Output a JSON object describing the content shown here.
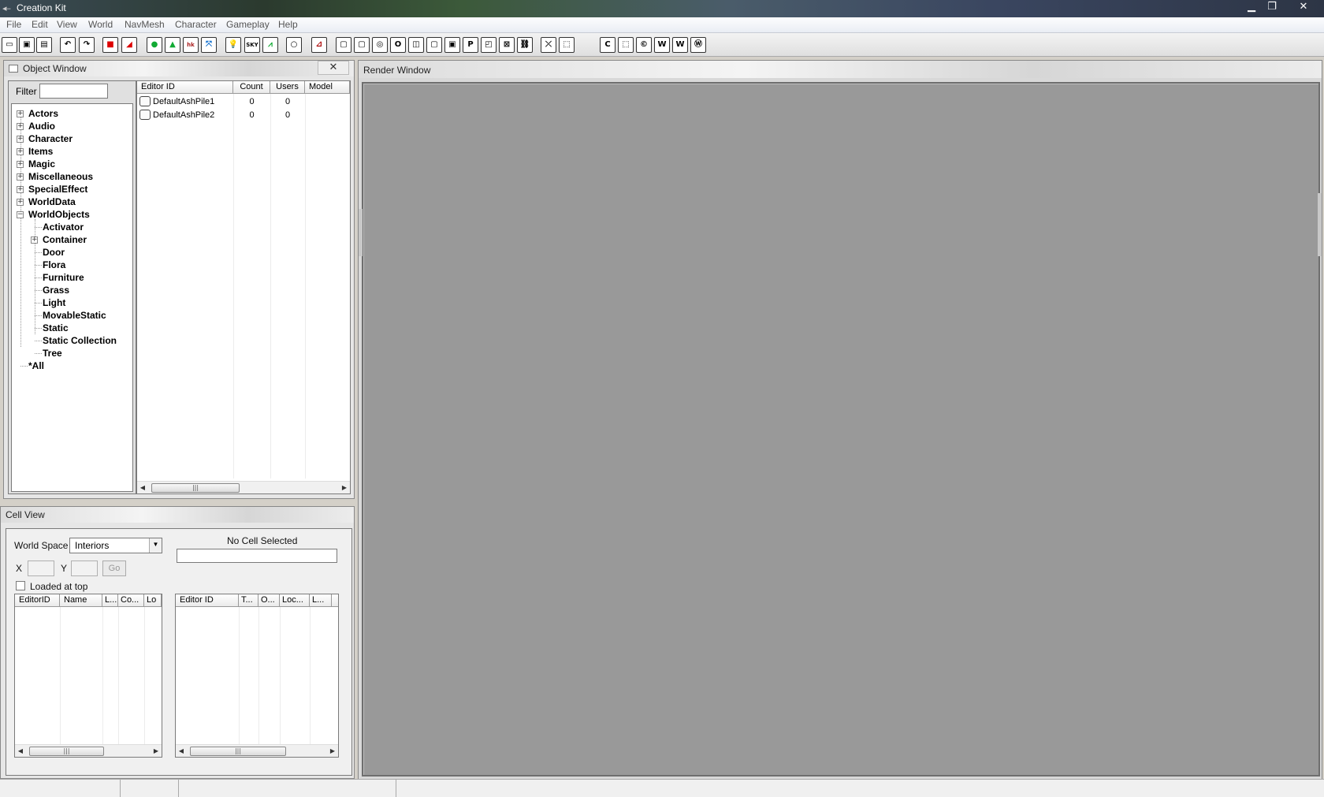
{
  "window": {
    "title": "Creation Kit"
  },
  "menu": [
    "File",
    "Edit",
    "View",
    "World",
    "NavMesh",
    "Character",
    "Gameplay",
    "Help"
  ],
  "toolbar_icons": [
    "open-icon",
    "save-icon",
    "save-as-icon",
    "undo-icon",
    "redo-icon",
    "red-square-icon",
    "triangle-icon",
    "green-sphere-icon",
    "landscape-icon",
    "havok-icon",
    "xy-icon",
    "light-bulb-icon",
    "sky-icon",
    "grass-icon",
    "lasso-icon",
    "graph-icon",
    "box1-icon",
    "box2-icon",
    "circle-box-icon",
    "o-box-icon",
    "split-box-icon",
    "box3-icon",
    "square-box-icon",
    "p-box-icon",
    "q-box-icon",
    "x-box-icon",
    "link-box-icon",
    "pick-icon",
    "cube-icon",
    "c-box-icon",
    "cube2-icon",
    "c-circle-icon",
    "w-box-icon",
    "w2-box-icon",
    "w-circle-icon"
  ],
  "object_window": {
    "title": "Object Window",
    "filter_label": "Filter",
    "filter_value": "",
    "tree": [
      {
        "label": "Actors",
        "level": 0,
        "expander": "+"
      },
      {
        "label": "Audio",
        "level": 0,
        "expander": "+"
      },
      {
        "label": "Character",
        "level": 0,
        "expander": "+"
      },
      {
        "label": "Items",
        "level": 0,
        "expander": "+"
      },
      {
        "label": "Magic",
        "level": 0,
        "expander": "+"
      },
      {
        "label": "Miscellaneous",
        "level": 0,
        "expander": "+"
      },
      {
        "label": "SpecialEffect",
        "level": 0,
        "expander": "+"
      },
      {
        "label": "WorldData",
        "level": 0,
        "expander": "+"
      },
      {
        "label": "WorldObjects",
        "level": 0,
        "expander": "−"
      },
      {
        "label": "Activator",
        "level": 1,
        "expander": ""
      },
      {
        "label": "Container",
        "level": 1,
        "expander": "+"
      },
      {
        "label": "Door",
        "level": 1,
        "expander": ""
      },
      {
        "label": "Flora",
        "level": 1,
        "expander": ""
      },
      {
        "label": "Furniture",
        "level": 1,
        "expander": ""
      },
      {
        "label": "Grass",
        "level": 1,
        "expander": ""
      },
      {
        "label": "Light",
        "level": 1,
        "expander": ""
      },
      {
        "label": "MovableStatic",
        "level": 1,
        "expander": ""
      },
      {
        "label": "Static",
        "level": 1,
        "expander": ""
      },
      {
        "label": "Static Collection",
        "level": 1,
        "expander": ""
      },
      {
        "label": "Tree",
        "level": 1,
        "expander": ""
      },
      {
        "label": "*All",
        "level": 0,
        "expander": ""
      }
    ],
    "columns": [
      "Editor ID",
      "Count",
      "Users",
      "Model"
    ],
    "rows": [
      {
        "editor_id": "DefaultAshPile1",
        "count": "0",
        "users": "0",
        "model": ""
      },
      {
        "editor_id": "DefaultAshPile2",
        "count": "0",
        "users": "0",
        "model": ""
      }
    ]
  },
  "cell_view": {
    "title": "Cell View",
    "world_space_label": "World Space",
    "world_space_value": "Interiors",
    "no_cell_label": "No Cell Selected",
    "x_label": "X",
    "y_label": "Y",
    "go_label": "Go",
    "loaded_at_top_label": "Loaded at top",
    "left_columns": [
      "EditorID",
      "Name",
      "L...",
      "Co...",
      "Lo"
    ],
    "right_columns": [
      "Editor ID",
      "T...",
      "O...",
      "Loc...",
      "L..."
    ]
  },
  "render_window": {
    "title": "Render Window"
  }
}
